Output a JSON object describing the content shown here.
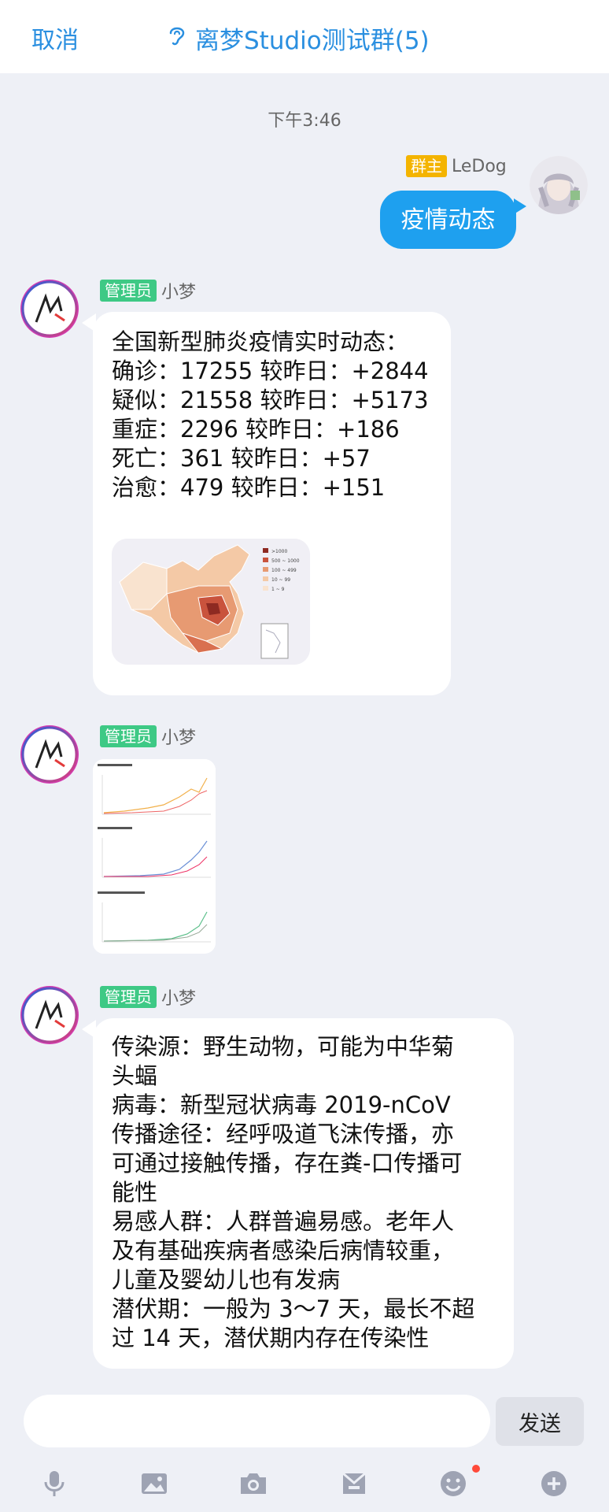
{
  "header": {
    "cancel_label": "取消",
    "title": "离梦Studio测试群(5)"
  },
  "timestamp": "下午3:46",
  "messages": {
    "m1": {
      "role_badge": "群主",
      "nickname": "LeDog",
      "text": "疫情动态"
    },
    "m2": {
      "role_badge": "管理员",
      "nickname": "小梦",
      "text": "全国新型肺炎疫情实时动态：\n确诊：17255 较昨日：+2844\n疑似：21558 较昨日：+5173\n重症：2296 较昨日：+186\n死亡：361 较昨日：+57\n治愈：479 较昨日：+151",
      "map_legend": [
        ">1000",
        "500 ~ 1000",
        "100 ~ 499",
        "10 ~ 99",
        "1 ~ 9"
      ]
    },
    "m3": {
      "role_badge": "管理员",
      "nickname": "小梦"
    },
    "m4": {
      "role_badge": "管理员",
      "nickname": "小梦",
      "text": "传染源：野生动物，可能为中华菊\n头蝠\n病毒：新型冠状病毒 2019-nCoV\n传播途径：经呼吸道飞沫传播，亦\n可通过接触传播，存在粪-口传播可\n能性\n易感人群：人群普遍易感。老年人\n及有基础疾病者感染后病情较重，\n儿童及婴幼儿也有发病\n潜伏期：一般为 3～7 天，最长不超\n过 14 天，潜伏期内存在传染性"
    }
  },
  "input": {
    "value": "",
    "send_label": "发送"
  },
  "toolbar_icons": [
    "microphone-icon",
    "image-icon",
    "camera-icon",
    "mailbox-icon",
    "emoji-icon",
    "plus-icon"
  ],
  "colors": {
    "accent": "#2a8fe0",
    "self_bubble": "#1ea0ef",
    "owner_badge": "#f4b400",
    "admin_badge": "#3ec985",
    "background": "#eef0f6"
  }
}
